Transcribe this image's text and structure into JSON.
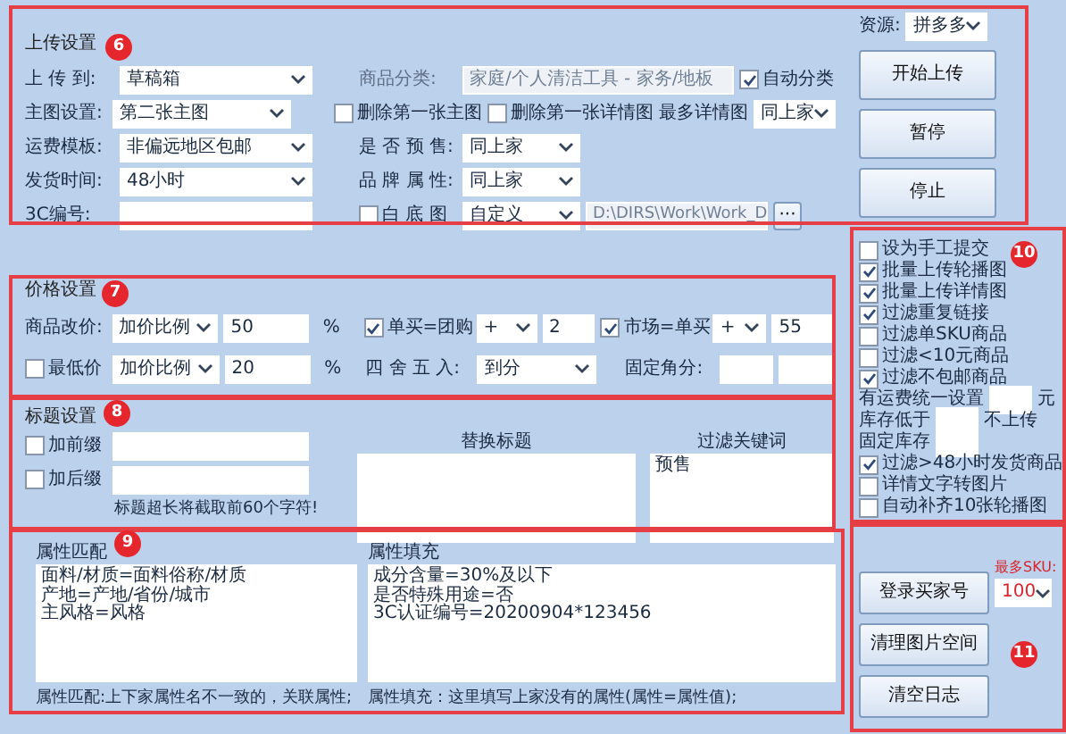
{
  "upload": {
    "title": "上传设置",
    "fields": [
      {
        "label": "上 传 到:",
        "value": "草稿箱"
      },
      {
        "label": "主图设置:",
        "value": "第二张主图"
      },
      {
        "label": "运费模板:",
        "value": "非偏远地区包邮"
      },
      {
        "label": "发货时间:",
        "value": "48小时"
      }
    ],
    "code_3c": {
      "label": "3C编号:"
    },
    "category": {
      "label": "商品分类:",
      "value": "家庭/个人清洁工具 - 家务/地板",
      "disabled": true
    },
    "auto_category": {
      "label": "自动分类",
      "checked": true
    },
    "delete_first_main": {
      "label": "删除第一张主图",
      "checked": false
    },
    "delete_first_detail": {
      "label": "删除第一张详情图",
      "checked": false
    },
    "max_detail": {
      "label": "最多详情图",
      "value": "同上家"
    },
    "presale": {
      "label": "是 否 预 售:",
      "value": "同上家"
    },
    "brand": {
      "label": "品 牌 属 性:",
      "value": "同上家"
    },
    "white_bg": {
      "label": "白 底 图",
      "checked": false,
      "mode": "自定义",
      "path": "D:\\DIRS\\Work\\Work_D",
      "browse": "···"
    }
  },
  "source": {
    "label": "资源:",
    "value": "拼多多"
  },
  "actions": [
    "开始上传",
    "暂停",
    "停止"
  ],
  "price": {
    "title": "价格设置",
    "change": {
      "label": "商品改价:",
      "mode": "加价比例",
      "value": "50",
      "unit": "%"
    },
    "min": {
      "label": "最低价",
      "checked": false,
      "mode": "加价比例",
      "value": "20",
      "unit": "%"
    },
    "single_group": {
      "label": "单买=团购",
      "checked": true,
      "op": "+",
      "value": "2"
    },
    "market_single": {
      "label": "市场=单买",
      "checked": true,
      "op": "+",
      "value": "55"
    },
    "rounding": {
      "label": "四 舍 五 入:",
      "value": "到分"
    },
    "fixed": {
      "label": "固定角分:"
    }
  },
  "title_settings": {
    "title": "标题设置",
    "prefix": {
      "label": "加前缀",
      "checked": false
    },
    "suffix": {
      "label": "加后缀",
      "checked": false
    },
    "note": "标题超长将截取前60个字符!",
    "replace": {
      "title": "替换标题"
    },
    "filter": {
      "title": "过滤关键词",
      "lines": [
        "预售"
      ]
    }
  },
  "attributes": {
    "match": {
      "title": "属性匹配",
      "lines": [
        "面料/材质=面料俗称/材质",
        "产地=产地/省份/城市",
        "主风格=风格"
      ],
      "note": "属性匹配:上下家属性名不一致的，关联属性;"
    },
    "fill": {
      "title": "属性填充",
      "lines": [
        "成分含量=30%及以下",
        "是否特殊用途=否",
        "3C认证编号=20200904*123456"
      ],
      "note": "属性填充：这里填写上家没有的属性(属性=属性值);"
    }
  },
  "options": [
    {
      "kind": "check",
      "label": "设为手工提交",
      "checked": false
    },
    {
      "kind": "check",
      "label": "批量上传轮播图",
      "checked": true
    },
    {
      "kind": "check",
      "label": "批量上传详情图",
      "checked": true
    },
    {
      "kind": "check",
      "label": "过滤重复链接",
      "checked": true
    },
    {
      "kind": "check",
      "label": "过滤单SKU商品",
      "checked": false
    },
    {
      "kind": "check",
      "label": "过滤<10元商品",
      "checked": false
    },
    {
      "kind": "check",
      "label": "过滤不包邮商品",
      "checked": true
    },
    {
      "kind": "input",
      "label": "有运费统一设置",
      "unit": "元"
    },
    {
      "kind": "input",
      "label": "库存低于",
      "unit": "不上传"
    },
    {
      "kind": "input",
      "label": "固定库存"
    },
    {
      "kind": "check",
      "label": "过滤>48小时发货商品",
      "checked": true
    },
    {
      "kind": "check",
      "label": "详情文字转图片",
      "checked": false
    },
    {
      "kind": "check",
      "label": "自动补齐10张轮播图",
      "checked": false
    }
  ],
  "bottom_buttons": [
    "登录买家号",
    "清理图片空间",
    "清空日志"
  ],
  "max_sku": {
    "label": "最多SKU:",
    "value": "100"
  },
  "annotations": [
    {
      "number": "6"
    },
    {
      "number": "7"
    },
    {
      "number": "8"
    },
    {
      "number": "9"
    },
    {
      "number": "10"
    },
    {
      "number": "11"
    }
  ]
}
